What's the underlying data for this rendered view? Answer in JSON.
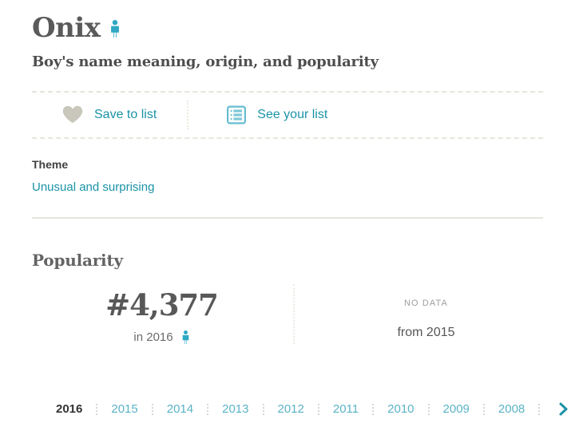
{
  "header": {
    "name": "Onix",
    "gender_icon": "boy-figure-icon",
    "subtitle": "Boy's name meaning, origin, and popularity"
  },
  "actions": {
    "save": {
      "icon": "heart-icon",
      "label": "Save to list"
    },
    "see_list": {
      "icon": "list-icon",
      "label": "See your list"
    }
  },
  "theme": {
    "label": "Theme",
    "value": "Unusual and surprising"
  },
  "popularity": {
    "heading": "Popularity",
    "primary": {
      "rank": "#4,377",
      "year_label": "in 2016",
      "gender_icon": "boy-figure-icon"
    },
    "secondary": {
      "status": "NO DATA",
      "year_label": "from 2015"
    }
  },
  "year_nav": {
    "years": [
      "2016",
      "2015",
      "2014",
      "2013",
      "2012",
      "2011",
      "2010",
      "2009",
      "2008"
    ],
    "active": "2016",
    "next_icon": "chevron-right-icon"
  },
  "colors": {
    "accent_teal": "#1b93a6",
    "figure_teal": "#2fa8c4",
    "year_link": "#5bb3c6",
    "heart_grey": "#c9c7bb",
    "divider": "#e7e5dd",
    "text_dark": "#4e4e4e"
  }
}
